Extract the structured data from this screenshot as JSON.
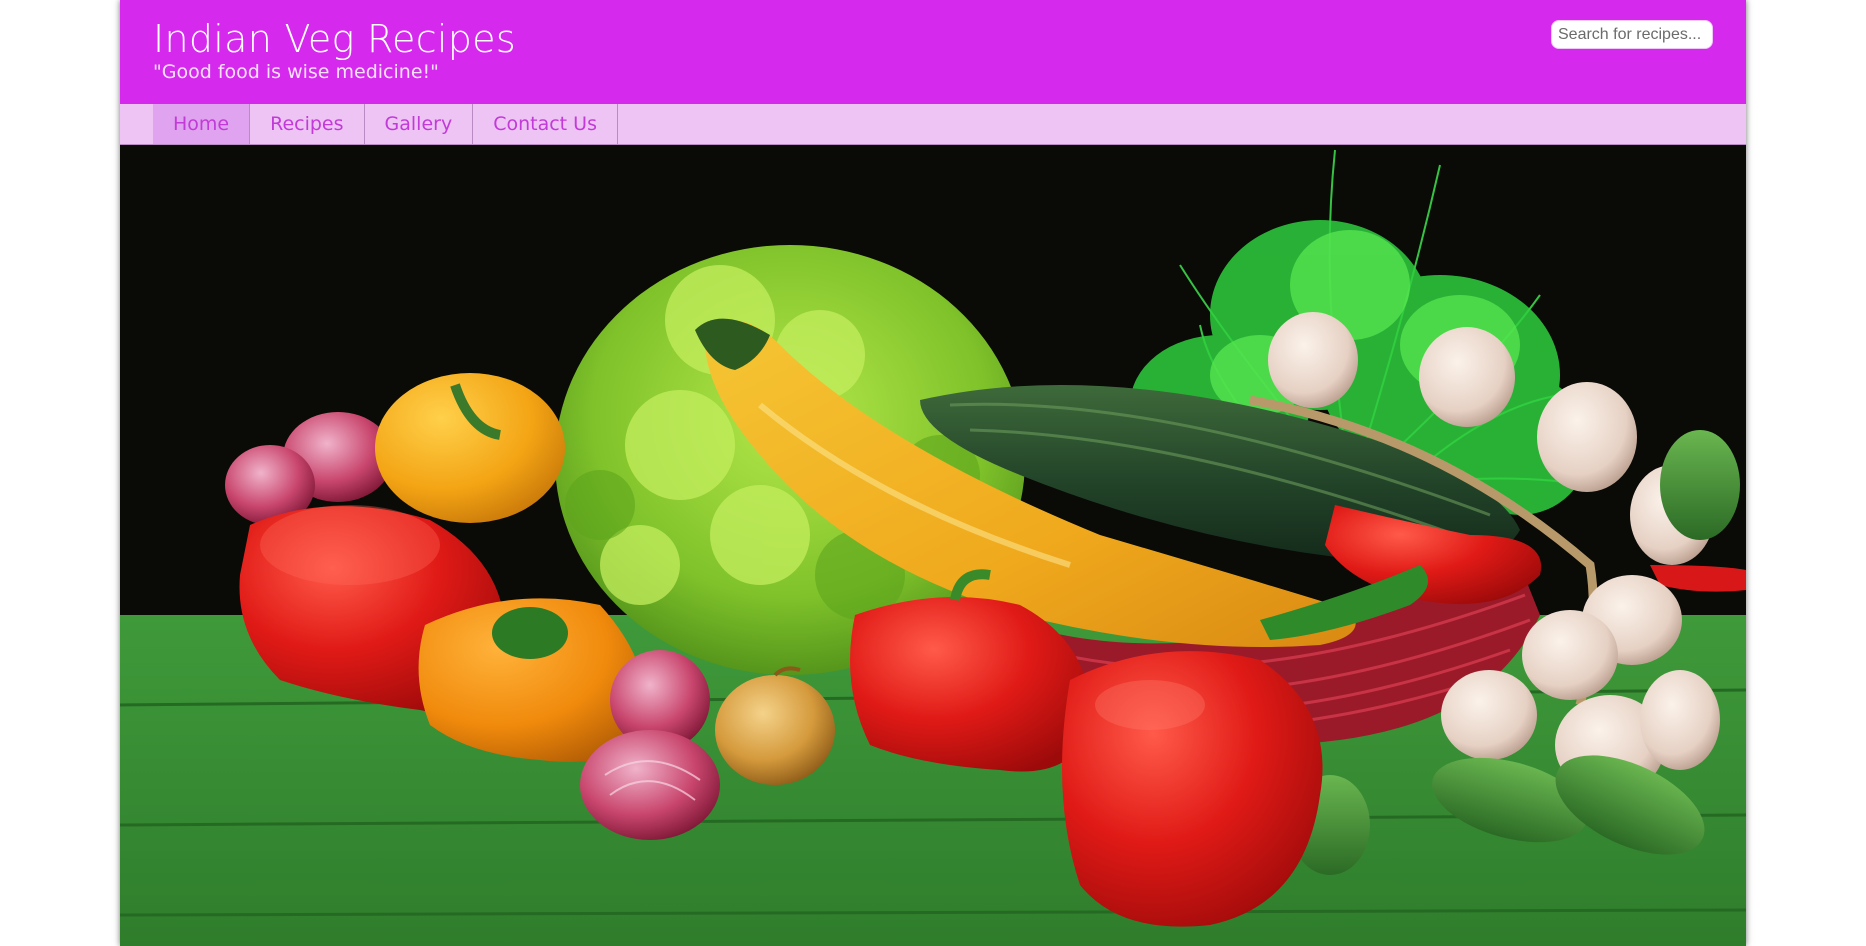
{
  "site": {
    "title": "Indian Veg Recipes",
    "tagline": "\"Good food is wise medicine!\""
  },
  "search": {
    "placeholder": "Search for recipes..."
  },
  "nav": {
    "items": [
      {
        "label": "Home",
        "active": true
      },
      {
        "label": "Recipes",
        "active": false
      },
      {
        "label": "Gallery",
        "active": false
      },
      {
        "label": "Contact Us",
        "active": false
      }
    ]
  },
  "colors": {
    "header_bg": "#d52aed",
    "nav_bg": "#eec4f4",
    "nav_active_bg": "#e0a3ef",
    "nav_text": "#c23ad8"
  },
  "hero": {
    "image": "vegetables-basket-photo"
  }
}
